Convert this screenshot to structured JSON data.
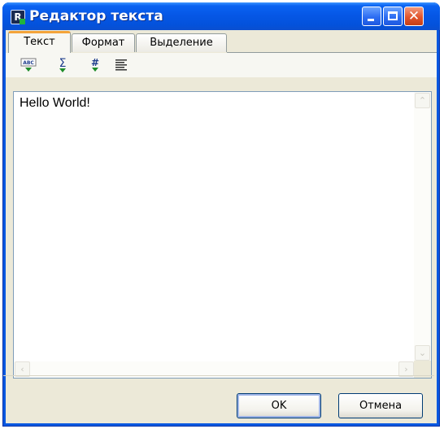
{
  "window": {
    "title": "Редактор текста"
  },
  "tabs": [
    {
      "label": "Текст",
      "active": true
    },
    {
      "label": "Формат",
      "active": false
    },
    {
      "label": "Выделение",
      "active": false
    }
  ],
  "toolbar": {
    "tools": [
      {
        "name": "spellcheck-icon",
        "glyph": "ABC"
      },
      {
        "name": "sum-icon",
        "glyph": "Σ"
      },
      {
        "name": "number-icon",
        "glyph": "#"
      },
      {
        "name": "align-justify-icon",
        "glyph": "≣"
      }
    ]
  },
  "editor": {
    "text": "Hello World!"
  },
  "buttons": {
    "ok": "OK",
    "cancel": "Отмена"
  },
  "colors": {
    "title_bar": "#0352dc",
    "dialog_bg": "#ece9d8",
    "active_tab_accent": "#f3a43a",
    "close_button": "#e2542c"
  }
}
